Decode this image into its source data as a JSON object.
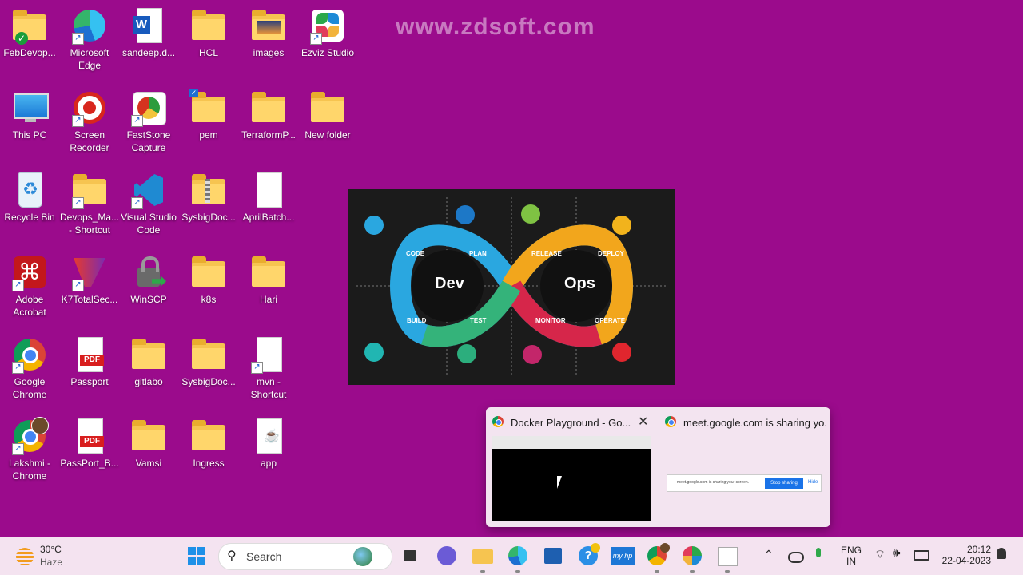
{
  "watermark": "www.zdsoft.com",
  "desktop_icons": {
    "febdevops": "FebDevop...",
    "edge": [
      "Microsoft",
      "Edge"
    ],
    "sandeep": "sandeep.d...",
    "hcl": "HCL",
    "images": "images",
    "ezviz": "Ezviz Studio",
    "thispc": "This PC",
    "screenrec": [
      "Screen",
      "Recorder"
    ],
    "faststone": [
      "FastStone",
      "Capture"
    ],
    "pem": "pem",
    "terraform": "TerraformP...",
    "newfolder": "New folder",
    "recycle": "Recycle Bin",
    "devops_ma": [
      "Devops_Ma...",
      "- Shortcut"
    ],
    "vscode": [
      "Visual Studio",
      "Code"
    ],
    "sysbig1": "SysbigDoc...",
    "aprilbatch": "AprilBatch...",
    "acrobat": [
      "Adobe",
      "Acrobat"
    ],
    "k7": "K7TotalSec...",
    "winscp": "WinSCP",
    "k8s": "k8s",
    "hari": "Hari",
    "chrome": [
      "Google",
      "Chrome"
    ],
    "passport": "Passport",
    "gitlabo": "gitlabo",
    "sysbig2": "SysbigDoc...",
    "mvn": [
      "mvn -",
      "Shortcut"
    ],
    "lakshmi": [
      "Lakshmi -",
      "Chrome"
    ],
    "passport_b": "PassPort_B...",
    "vamsi": "Vamsi",
    "ingress": "Ingress",
    "app": "app",
    "pdf_badge": "PDF"
  },
  "devops_graphic": {
    "dev": "Dev",
    "ops": "Ops",
    "stages": [
      "CODE",
      "PLAN",
      "RELEASE",
      "DEPLOY",
      "BUILD",
      "TEST",
      "MONITOR",
      "OPERATE"
    ]
  },
  "taskbar_popup": {
    "window1_title": "Docker Playground - Go...",
    "window2_title": "meet.google.com is sharing yo...",
    "sharing_text": "meet.google.com is sharing your screen.",
    "stop_sharing": "Stop sharing",
    "hide": "Hide"
  },
  "taskbar": {
    "weather_temp": "30°C",
    "weather_desc": "Haze",
    "search_placeholder": "Search",
    "lang1": "ENG",
    "lang2": "IN",
    "time": "20:12",
    "date": "22-04-2023"
  },
  "colors": {
    "desktop_bg": "#9b0b8c",
    "taskbar_bg": "#f4e3f0",
    "accent": "#1a73e8"
  }
}
